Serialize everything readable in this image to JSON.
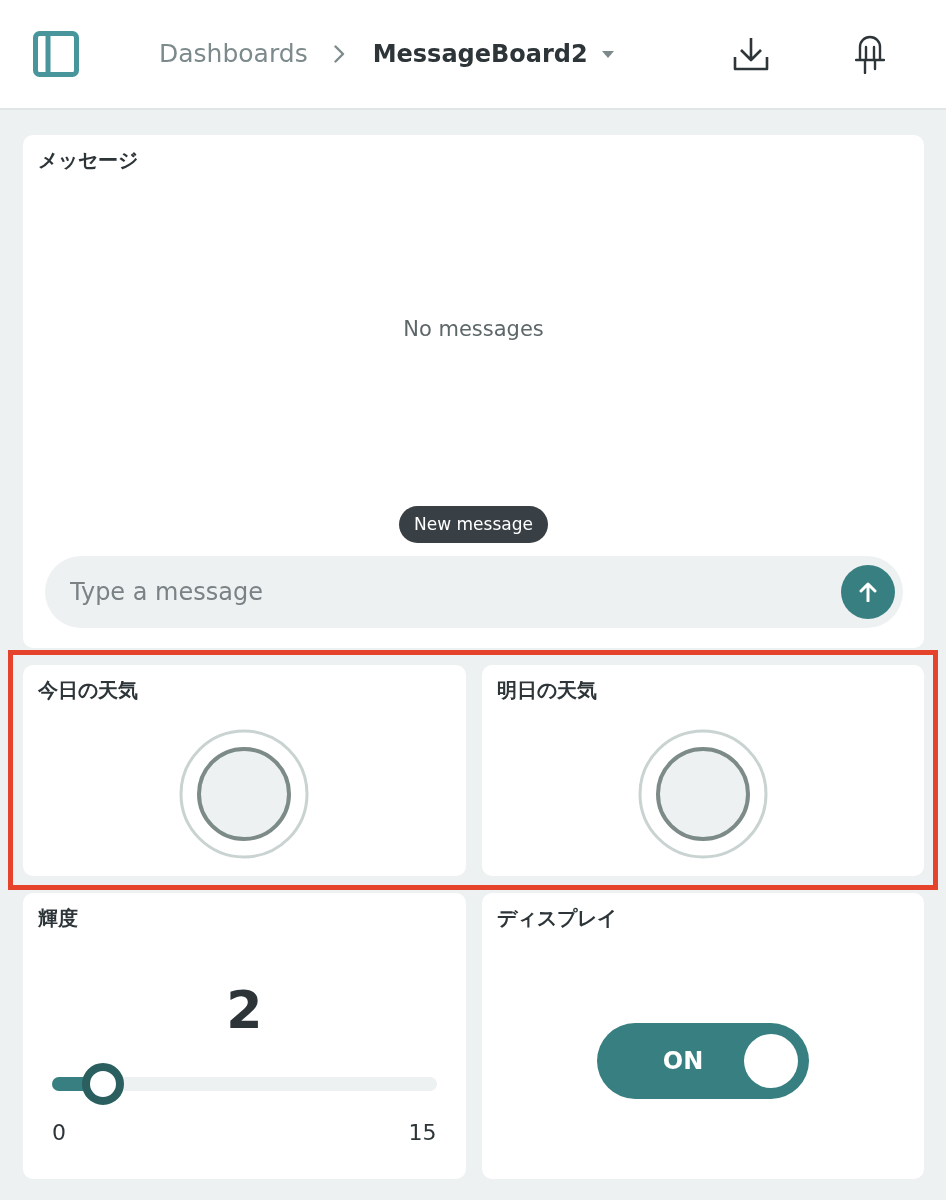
{
  "header": {
    "breadcrumb": [
      {
        "label": "Dashboards",
        "current": false
      },
      {
        "label": "MessageBoard2",
        "current": true
      }
    ]
  },
  "message_widget": {
    "title": "メッセージ",
    "empty_text": "No messages",
    "new_message_badge": "New message",
    "input": {
      "placeholder": "Type a message"
    }
  },
  "weather_widgets": {
    "highlighted": true,
    "items": [
      {
        "title": "今日の天気",
        "lit": false
      },
      {
        "title": "明日の天気",
        "lit": false
      }
    ]
  },
  "brightness_widget": {
    "title": "輝度",
    "value": "2",
    "level": 0.133,
    "min": "0",
    "max": "15"
  },
  "display_widget": {
    "title": "ディスプレイ",
    "switch": {
      "on": true,
      "label": "ON"
    }
  }
}
